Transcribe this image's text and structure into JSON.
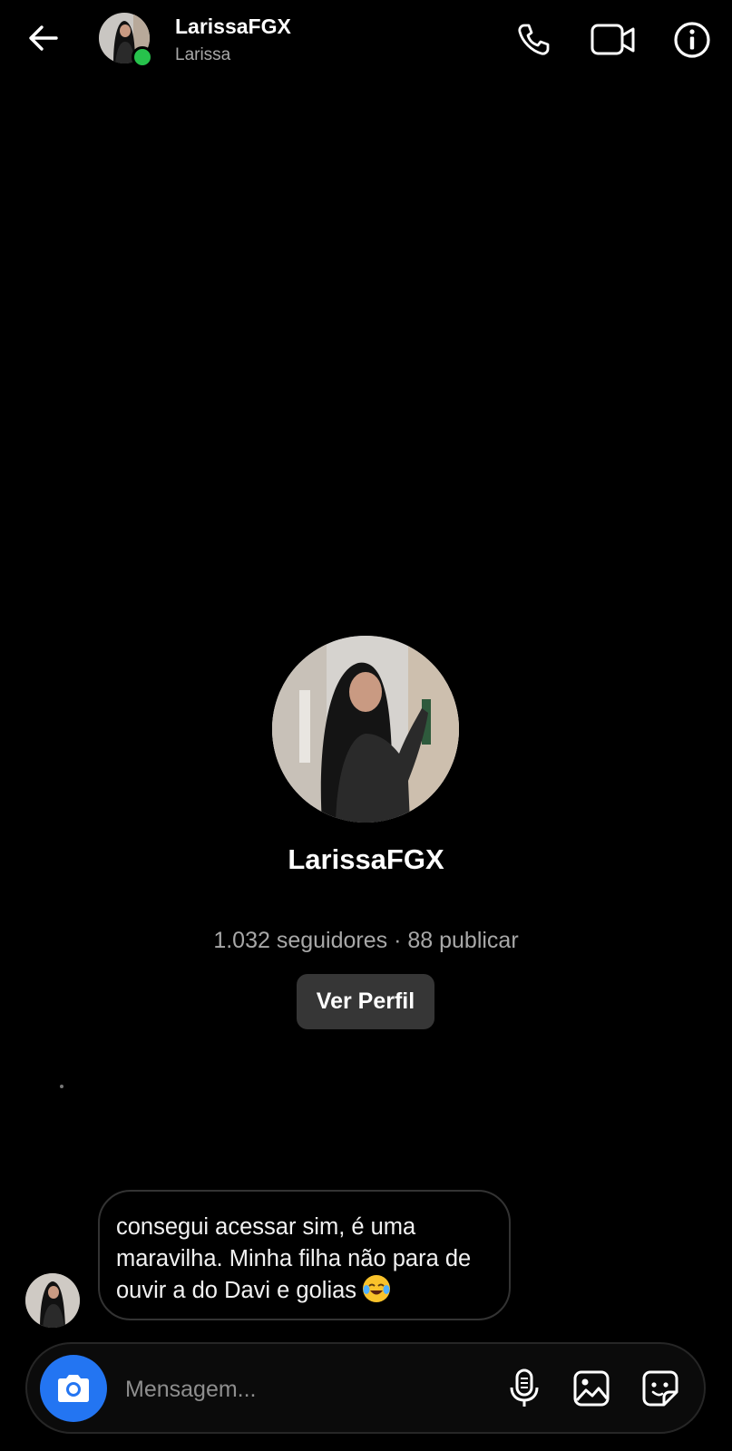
{
  "header": {
    "username": "LarissaFGX",
    "display_name": "Larissa",
    "status": "online",
    "icons": [
      "back-arrow-icon",
      "phone-icon",
      "video-camera-icon",
      "info-icon"
    ]
  },
  "profile": {
    "username": "LarissaFGX",
    "stats": "1.032 seguidores · 88 publicar",
    "view_profile_label": "Ver Perfil"
  },
  "messages": [
    {
      "sender": "LarissaFGX",
      "text": "consegui acessar sim, é uma maravilha. Minha filha não para de ouvir a do Davi e golias",
      "emoji": "face-with-tears-of-joy"
    }
  ],
  "composer": {
    "placeholder": "Mensagem...",
    "icons": [
      "camera-icon",
      "microphone-icon",
      "gallery-icon",
      "sticker-icon"
    ]
  },
  "colors": {
    "background": "#000000",
    "accent": "#2375f2",
    "online": "#27c24c",
    "secondary_text": "#a8a8a8"
  }
}
